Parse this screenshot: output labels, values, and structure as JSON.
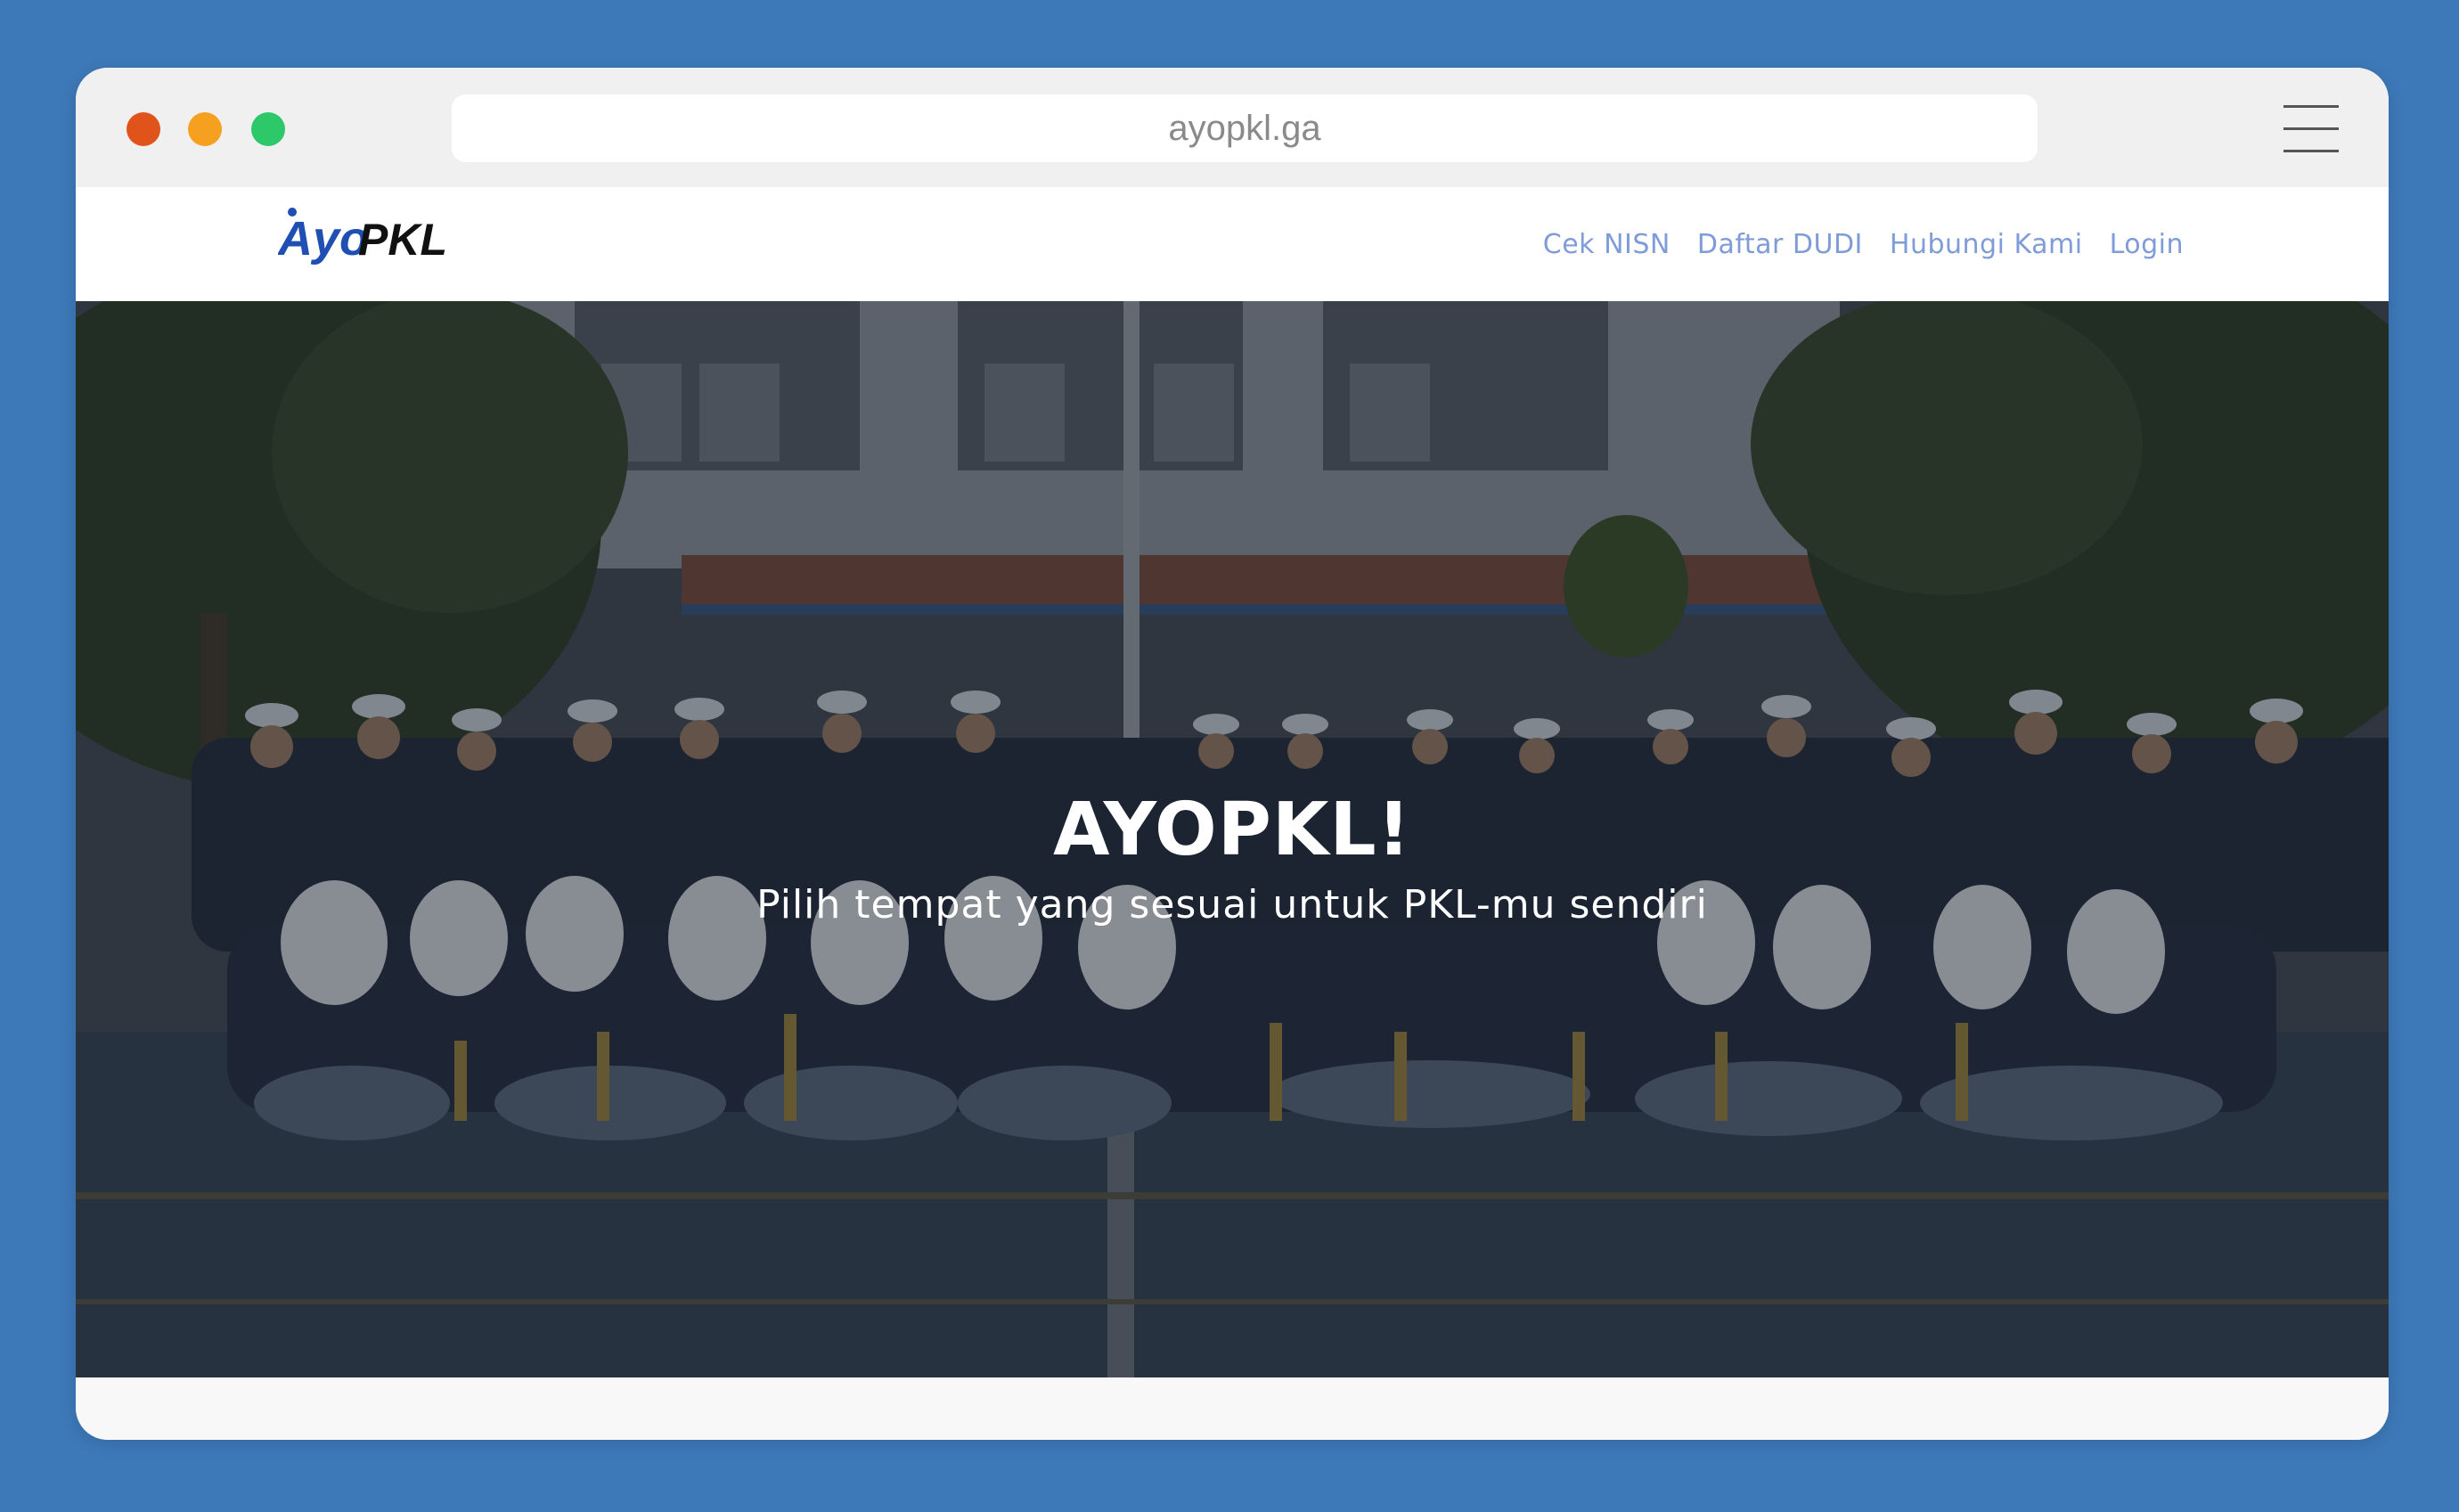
{
  "browser": {
    "url": "ayopkl.ga",
    "menu_icon": "hamburger-icon",
    "traffic_lights": [
      "close-dot",
      "minimize-dot",
      "maximize-dot"
    ]
  },
  "header": {
    "logo_text": "AyoPKL",
    "nav": [
      {
        "label": "Cek NISN"
      },
      {
        "label": "Daftar DUDI"
      },
      {
        "label": "Hubungi Kami"
      },
      {
        "label": "Login"
      }
    ]
  },
  "hero": {
    "title": "AYOPKL!",
    "subtitle": "Pilih tempat yang sesuai untuk PKL-mu sendiri"
  },
  "colors": {
    "page_background": "#3d78b8",
    "nav_link": "#7f9bd8",
    "logo_blue": "#1f4fb3",
    "hero_overlay": "#1c2430"
  }
}
